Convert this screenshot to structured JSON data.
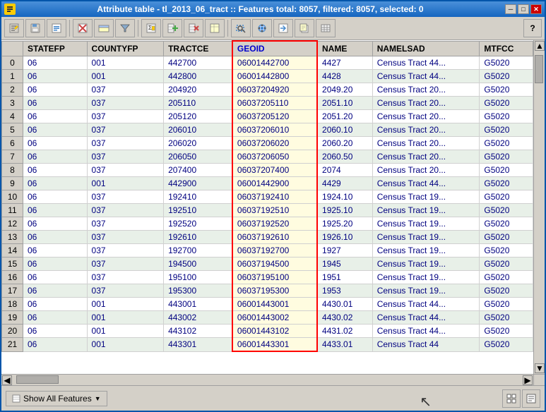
{
  "window": {
    "title": "Attribute table - tl_2013_06_tract :: Features total: 8057, filtered: 8057, selected: 0",
    "icon": "🗂"
  },
  "title_buttons": {
    "minimize": "─",
    "maximize": "□",
    "close": "✕"
  },
  "toolbar": {
    "help_label": "?",
    "buttons": [
      "✏",
      "💾",
      "📋",
      "⊞",
      "↩",
      "↪",
      "✂",
      "🗑",
      "🔍",
      "📄",
      "🔀",
      "📊",
      "📁",
      "🖩",
      "📋",
      "📋"
    ]
  },
  "columns": [
    "STATEFP",
    "COUNTYFP",
    "TRACTCE",
    "GEOID",
    "NAME",
    "NAMELSAD",
    "MTFCC"
  ],
  "rows": [
    {
      "id": 0,
      "statefp": "06",
      "countyfp": "001",
      "tractce": "442700",
      "geoid": "06001442700",
      "name": "4427",
      "namelsad": "Census Tract 44...",
      "mtfcc": "G5020"
    },
    {
      "id": 1,
      "statefp": "06",
      "countyfp": "001",
      "tractce": "442800",
      "geoid": "06001442800",
      "name": "4428",
      "namelsad": "Census Tract 44...",
      "mtfcc": "G5020"
    },
    {
      "id": 2,
      "statefp": "06",
      "countyfp": "037",
      "tractce": "204920",
      "geoid": "06037204920",
      "name": "2049.20",
      "namelsad": "Census Tract 20...",
      "mtfcc": "G5020"
    },
    {
      "id": 3,
      "statefp": "06",
      "countyfp": "037",
      "tractce": "205110",
      "geoid": "06037205110",
      "name": "2051.10",
      "namelsad": "Census Tract 20...",
      "mtfcc": "G5020"
    },
    {
      "id": 4,
      "statefp": "06",
      "countyfp": "037",
      "tractce": "205120",
      "geoid": "06037205120",
      "name": "2051.20",
      "namelsad": "Census Tract 20...",
      "mtfcc": "G5020"
    },
    {
      "id": 5,
      "statefp": "06",
      "countyfp": "037",
      "tractce": "206010",
      "geoid": "06037206010",
      "name": "2060.10",
      "namelsad": "Census Tract 20...",
      "mtfcc": "G5020"
    },
    {
      "id": 6,
      "statefp": "06",
      "countyfp": "037",
      "tractce": "206020",
      "geoid": "06037206020",
      "name": "2060.20",
      "namelsad": "Census Tract 20...",
      "mtfcc": "G5020"
    },
    {
      "id": 7,
      "statefp": "06",
      "countyfp": "037",
      "tractce": "206050",
      "geoid": "06037206050",
      "name": "2060.50",
      "namelsad": "Census Tract 20...",
      "mtfcc": "G5020"
    },
    {
      "id": 8,
      "statefp": "06",
      "countyfp": "037",
      "tractce": "207400",
      "geoid": "06037207400",
      "name": "2074",
      "namelsad": "Census Tract 20...",
      "mtfcc": "G5020"
    },
    {
      "id": 9,
      "statefp": "06",
      "countyfp": "001",
      "tractce": "442900",
      "geoid": "06001442900",
      "name": "4429",
      "namelsad": "Census Tract 44...",
      "mtfcc": "G5020"
    },
    {
      "id": 10,
      "statefp": "06",
      "countyfp": "037",
      "tractce": "192410",
      "geoid": "06037192410",
      "name": "1924.10",
      "namelsad": "Census Tract 19...",
      "mtfcc": "G5020"
    },
    {
      "id": 11,
      "statefp": "06",
      "countyfp": "037",
      "tractce": "192510",
      "geoid": "06037192510",
      "name": "1925.10",
      "namelsad": "Census Tract 19...",
      "mtfcc": "G5020"
    },
    {
      "id": 12,
      "statefp": "06",
      "countyfp": "037",
      "tractce": "192520",
      "geoid": "06037192520",
      "name": "1925.20",
      "namelsad": "Census Tract 19...",
      "mtfcc": "G5020"
    },
    {
      "id": 13,
      "statefp": "06",
      "countyfp": "037",
      "tractce": "192610",
      "geoid": "06037192610",
      "name": "1926.10",
      "namelsad": "Census Tract 19...",
      "mtfcc": "G5020"
    },
    {
      "id": 14,
      "statefp": "06",
      "countyfp": "037",
      "tractce": "192700",
      "geoid": "06037192700",
      "name": "1927",
      "namelsad": "Census Tract 19...",
      "mtfcc": "G5020"
    },
    {
      "id": 15,
      "statefp": "06",
      "countyfp": "037",
      "tractce": "194500",
      "geoid": "06037194500",
      "name": "1945",
      "namelsad": "Census Tract 19...",
      "mtfcc": "G5020"
    },
    {
      "id": 16,
      "statefp": "06",
      "countyfp": "037",
      "tractce": "195100",
      "geoid": "06037195100",
      "name": "1951",
      "namelsad": "Census Tract 19...",
      "mtfcc": "G5020"
    },
    {
      "id": 17,
      "statefp": "06",
      "countyfp": "037",
      "tractce": "195300",
      "geoid": "06037195300",
      "name": "1953",
      "namelsad": "Census Tract 19...",
      "mtfcc": "G5020"
    },
    {
      "id": 18,
      "statefp": "06",
      "countyfp": "001",
      "tractce": "443001",
      "geoid": "06001443001",
      "name": "4430.01",
      "namelsad": "Census Tract 44...",
      "mtfcc": "G5020"
    },
    {
      "id": 19,
      "statefp": "06",
      "countyfp": "001",
      "tractce": "443002",
      "geoid": "06001443002",
      "name": "4430.02",
      "namelsad": "Census Tract 44...",
      "mtfcc": "G5020"
    },
    {
      "id": 20,
      "statefp": "06",
      "countyfp": "001",
      "tractce": "443102",
      "geoid": "06001443102",
      "name": "4431.02",
      "namelsad": "Census Tract 44...",
      "mtfcc": "G5020"
    },
    {
      "id": 21,
      "statefp": "06",
      "countyfp": "001",
      "tractce": "443301",
      "geoid": "06001443301",
      "name": "4433.01",
      "namelsad": "Census Tract 44",
      "mtfcc": "G5020"
    }
  ],
  "bottom": {
    "show_features_label": "Show All Features",
    "dropdown_arrow": "▼"
  },
  "colors": {
    "geoid_border": "#cc0000",
    "header_bg": "#d4d0c8",
    "row_alt": "#e8f0e8",
    "geoid_bg": "#fffce0",
    "link_color": "#000080"
  }
}
